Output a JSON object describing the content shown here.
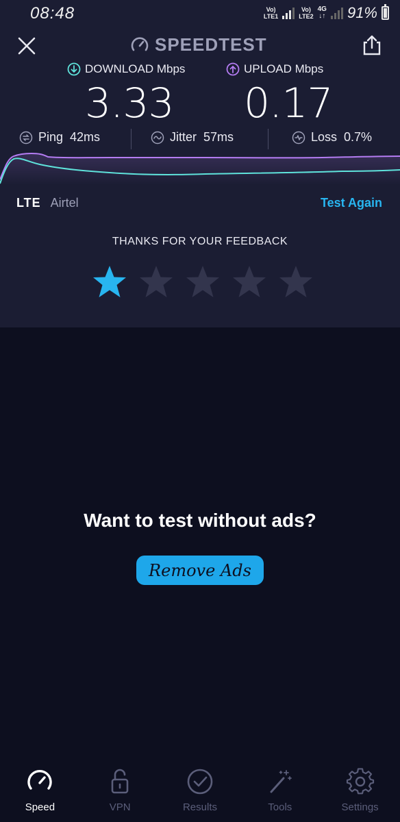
{
  "status_bar": {
    "time": "08:48",
    "sim1": {
      "top": "Vo)",
      "bottom": "LTE1"
    },
    "sim2": {
      "top": "Vo)",
      "bottom": "LTE2"
    },
    "network": "4G",
    "battery": "91%"
  },
  "header": {
    "brand": "SPEEDTEST"
  },
  "results": {
    "download_label": "DOWNLOAD Mbps",
    "download_value": "3.33",
    "upload_label": "UPLOAD Mbps",
    "upload_value": "0.17",
    "ping_label": "Ping",
    "ping_value": "42ms",
    "jitter_label": "Jitter",
    "jitter_value": "57ms",
    "loss_label": "Loss",
    "loss_value": "0.7%"
  },
  "connection": {
    "tech": "LTE",
    "carrier": "Airtel",
    "test_again": "Test Again"
  },
  "feedback": {
    "title": "THANKS FOR YOUR FEEDBACK",
    "rating": 1,
    "max": 5
  },
  "ads": {
    "title": "Want to test without ads?",
    "button": "Remove Ads"
  },
  "tabs": [
    {
      "label": "Speed",
      "icon": "speedometer-icon",
      "active": true
    },
    {
      "label": "VPN",
      "icon": "lock-icon",
      "active": false
    },
    {
      "label": "Results",
      "icon": "check-circle-icon",
      "active": false
    },
    {
      "label": "Tools",
      "icon": "magic-wand-icon",
      "active": false
    },
    {
      "label": "Settings",
      "icon": "gear-icon",
      "active": false
    }
  ],
  "colors": {
    "download": "#5fe3db",
    "upload": "#b47cf2",
    "accent": "#28b5f0",
    "panel": "#1b1d33",
    "background": "#0d0f1f"
  }
}
